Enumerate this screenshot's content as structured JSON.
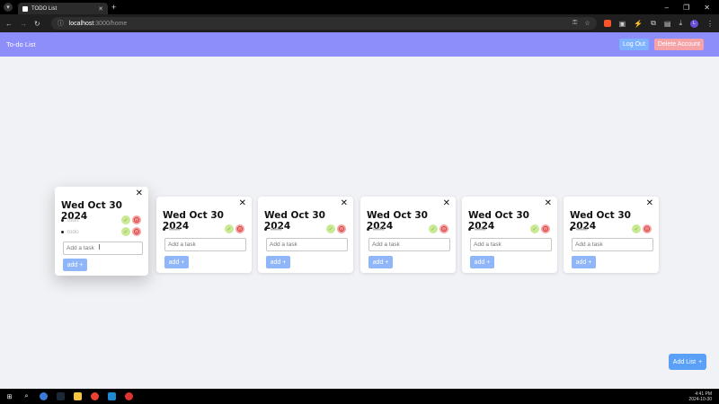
{
  "browser": {
    "tab_title": "TODO List",
    "new_tab_symbol": "+",
    "url_host": "localhost",
    "url_path": ":3000/home",
    "window_controls": [
      "–",
      "❐",
      "✕"
    ]
  },
  "header": {
    "title": "To-do List",
    "logout_label": "Log Out",
    "delete_account_label": "Delete Account"
  },
  "lists": [
    {
      "date": "Wed Oct 30 2024",
      "tasks": [
        {
          "text": "todo",
          "done": false
        },
        {
          "text": "todo",
          "done": false
        }
      ],
      "input_placeholder": "Add a task",
      "add_label": "add"
    },
    {
      "date": "Wed Oct 30 2024",
      "tasks": [
        {
          "text": "todo",
          "done": true
        }
      ],
      "input_placeholder": "Add a task",
      "add_label": "add"
    },
    {
      "date": "Wed Oct 30 2024",
      "tasks": [
        {
          "text": "todo",
          "done": true
        }
      ],
      "input_placeholder": "Add a task",
      "add_label": "add"
    },
    {
      "date": "Wed Oct 30 2024",
      "tasks": [
        {
          "text": "todo",
          "done": true
        }
      ],
      "input_placeholder": "Add a task",
      "add_label": "add"
    },
    {
      "date": "Wed Oct 30 2024",
      "tasks": [
        {
          "text": "todo",
          "done": true
        }
      ],
      "input_placeholder": "Add a task",
      "add_label": "add"
    },
    {
      "date": "Wed Oct 30 2024",
      "tasks": [
        {
          "text": "todo",
          "done": true
        }
      ],
      "input_placeholder": "Add a task",
      "add_label": "add"
    }
  ],
  "add_list_label": "Add List",
  "taskbar": {
    "time": "4:41 PM",
    "date": "2024-10-30"
  },
  "colors": {
    "header_bg": "#8e8efb",
    "logout_bg": "#7fb2ff",
    "delete_bg": "#f6a3a8",
    "add_bg": "#8fb6f9",
    "add_list_bg": "#5aa0f7"
  }
}
